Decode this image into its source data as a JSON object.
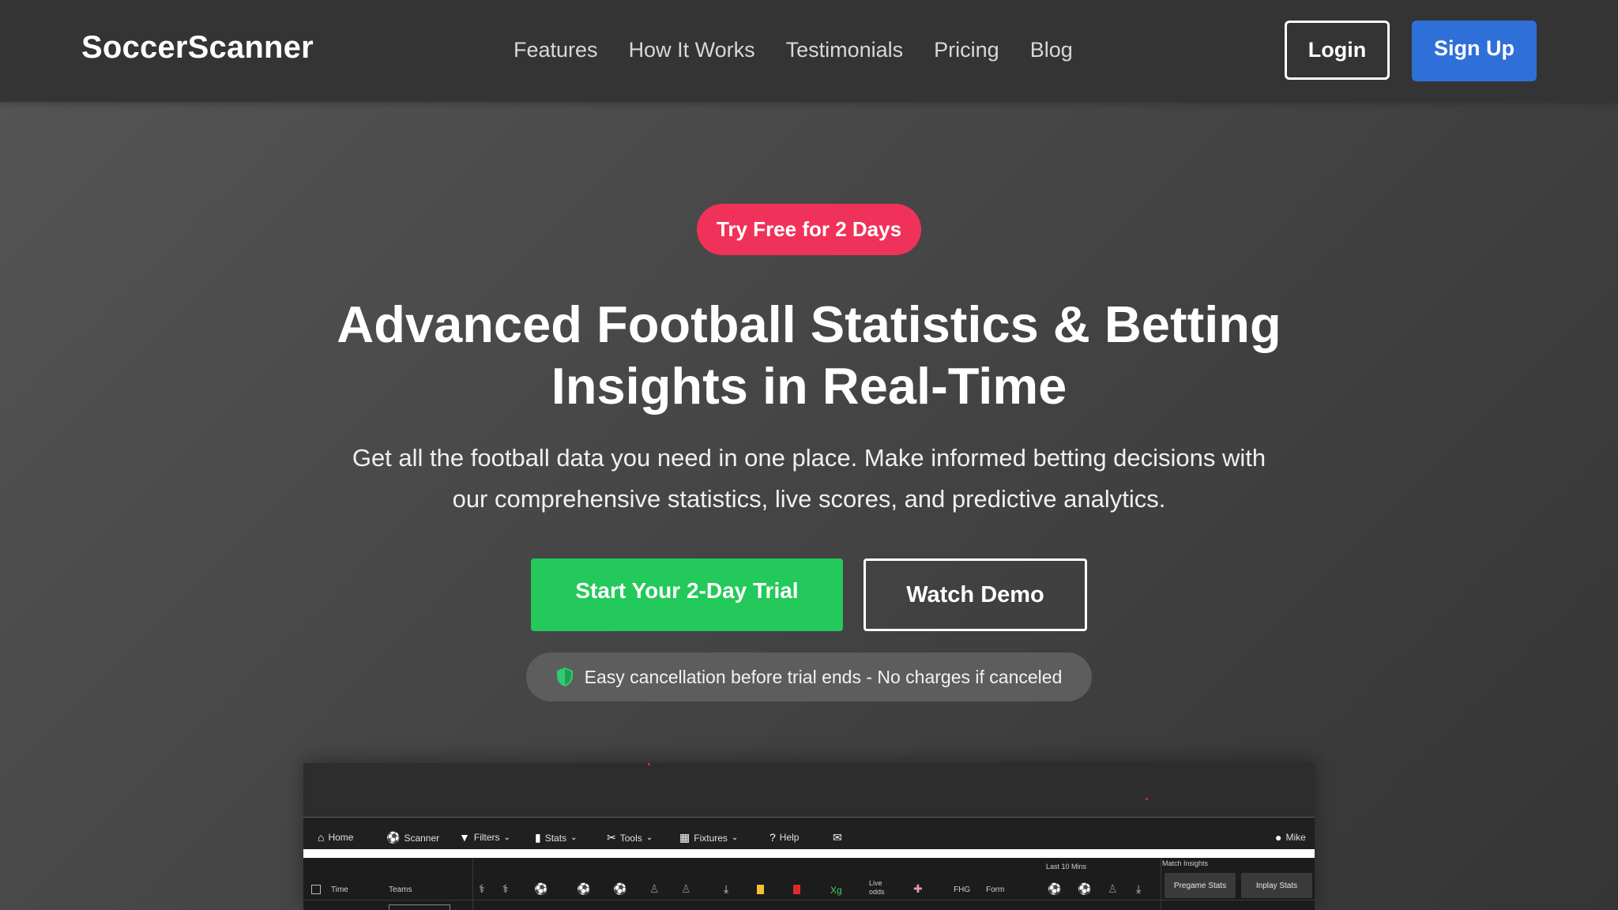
{
  "nav": {
    "brand": "SoccerScanner",
    "links": [
      "Features",
      "How It Works",
      "Testimonials",
      "Pricing",
      "Blog"
    ],
    "login_label": "Login",
    "signup_label": "Sign Up"
  },
  "hero": {
    "badge": "Try Free for 2 Days",
    "headline_line1": "Advanced Football Statistics & Betting",
    "headline_line2": "Insights in Real-Time",
    "subtext_line1": "Get all the football data you need in one place. Make informed betting decisions with",
    "subtext_line2": "our comprehensive statistics, live scores, and predictive analytics.",
    "primary_cta": "Start Your 2-Day Trial",
    "secondary_cta": "Watch Demo",
    "note": "Easy cancellation before trial ends - No charges if canceled"
  },
  "app_preview": {
    "menu": {
      "home": "Home",
      "scanner": "Scanner",
      "filters": "Filters",
      "stats": "Stats",
      "tools": "Tools",
      "fixtures": "Fixtures",
      "help": "Help",
      "user": "Mike"
    },
    "table": {
      "time": "Time",
      "teams": "Teams",
      "xg": "Xg",
      "live_odds_1": "Live",
      "live_odds_2": "odds",
      "fhg": "FHG",
      "form": "Form",
      "last10": "Last 10 Mins",
      "match_insights": "Match Insights",
      "pregame": "Pregame Stats",
      "inplay": "Inplay Stats"
    }
  },
  "colors": {
    "badge": "#f0325a",
    "signup": "#2f6fd8",
    "trial": "#23c95a",
    "shield": "#2ecc71"
  }
}
